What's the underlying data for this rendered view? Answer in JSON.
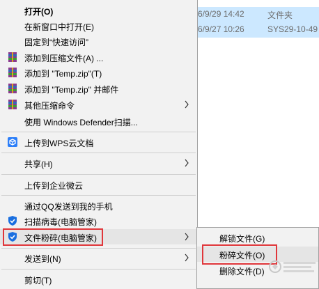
{
  "file_list": {
    "rows": [
      {
        "date": "6/9/29 14:42",
        "type": "文件夹"
      },
      {
        "date": "6/9/27 10:26",
        "type": "SYS29-10-49"
      }
    ]
  },
  "context_menu": {
    "items": [
      {
        "label": "打开(O)",
        "icon": "none"
      },
      {
        "label": "在新窗口中打开(E)",
        "icon": "none"
      },
      {
        "label": "固定到“快速访问”",
        "icon": "none"
      },
      {
        "label": "添加到压缩文件(A) ...",
        "icon": "winrar-archive-icon"
      },
      {
        "label": "添加到 \"Temp.zip\"(T)",
        "icon": "winrar-archive-icon"
      },
      {
        "label": "添加到 \"Temp.zip\" 并邮件",
        "icon": "winrar-archive-icon"
      },
      {
        "label": "其他压缩命令",
        "icon": "winrar-archive-icon"
      },
      {
        "label": "使用 Windows Defender扫描...",
        "icon": "none"
      },
      {
        "label": "上传到WPS云文档",
        "icon": "wps-cloud-icon"
      },
      {
        "label": "共享(H)",
        "icon": "none"
      },
      {
        "label": "上传到企业微云",
        "icon": "none"
      },
      {
        "label": "通过QQ发送到我的手机",
        "icon": "none"
      },
      {
        "label": "扫描病毒(电脑管家)",
        "icon": "tencent-shield-icon"
      },
      {
        "label": "文件粉碎(电脑管家)",
        "icon": "tencent-shield-icon"
      },
      {
        "label": "发送到(N)",
        "icon": "none"
      },
      {
        "label": "剪切(T)",
        "icon": "none"
      }
    ]
  },
  "sub_menu": {
    "items": [
      {
        "label": "解锁文件(G)"
      },
      {
        "label": "粉碎文件(O)"
      },
      {
        "label": "删除文件(D)"
      }
    ]
  },
  "colors": {
    "menu_bg": "#f2f2f2",
    "hover_bg": "#e5e5e5",
    "highlight_red": "#e0363a",
    "selection_blue": "#cce8ff",
    "winrar_red": "#b8321c",
    "wps_blue": "#2d7ff9",
    "tencent_blue": "#1a6fe0"
  }
}
